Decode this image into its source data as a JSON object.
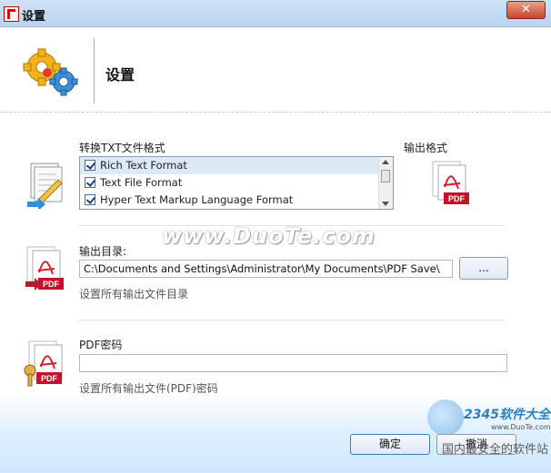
{
  "window": {
    "title": "设置",
    "close_label": "✕"
  },
  "header": {
    "title": "设置"
  },
  "convert": {
    "label": "转换TXT文件格式",
    "items": [
      {
        "label": "Rich Text Format",
        "checked": true
      },
      {
        "label": "Text File Format",
        "checked": true
      },
      {
        "label": "Hyper Text Markup Language Format",
        "checked": true
      }
    ]
  },
  "output_format": {
    "label": "输出格式",
    "icon_text": "PDF"
  },
  "output_dir": {
    "label": "输出目录:",
    "value": "C:\\Documents and Settings\\Administrator\\My Documents\\PDF Save\\",
    "browse_label": "...",
    "hint": "设置所有输出文件目录",
    "icon_text": "PDF"
  },
  "pdf_password": {
    "label": "PDF密码",
    "value": "",
    "hint": "设置所有输出文件(PDF)密码",
    "icon_text": "PDF"
  },
  "buttons": {
    "ok": "确定",
    "cancel": "撤消"
  },
  "watermarks": {
    "center": "www.DuoTe.com",
    "logo": "2345软件大全",
    "site": "www.DuoTe.com",
    "corner": "国内最安全的软件站"
  },
  "colors": {
    "title_bar": "#b9d3ee",
    "close_button": "#c8462c",
    "pdf_red": "#c8102e",
    "footer": "#cfe8ff"
  }
}
